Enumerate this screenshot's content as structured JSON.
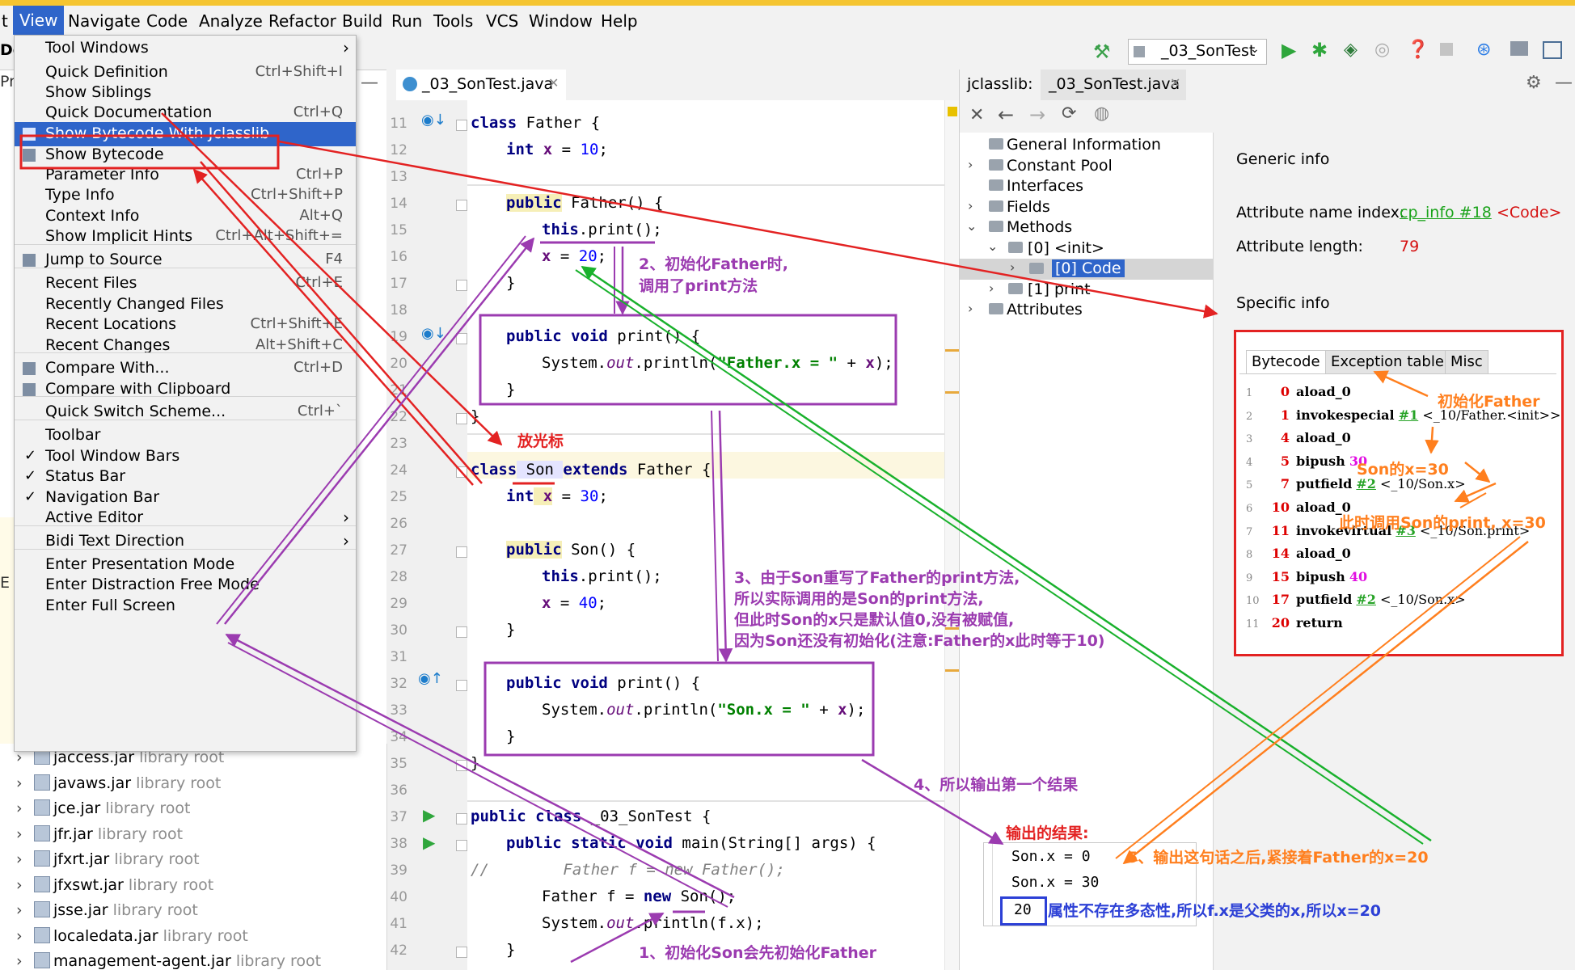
{
  "menubar": {
    "items": [
      "t",
      "View",
      "Navigate",
      "Code",
      "Analyze",
      "Refactor",
      "Build",
      "Run",
      "Tools",
      "VCS",
      "Window",
      "Help"
    ]
  },
  "toolbar": {
    "run_config": "_03_SonTest"
  },
  "left_edge": {
    "de": "De",
    "pro": "Pro",
    "e": "E"
  },
  "view_menu": {
    "items": [
      {
        "label": "Tool Windows",
        "shortcut": "",
        "submenu": true
      },
      {
        "label": "Quick Definition",
        "shortcut": "Ctrl+Shift+I"
      },
      {
        "label": "Show Siblings",
        "shortcut": ""
      },
      {
        "label": "Quick Documentation",
        "shortcut": "Ctrl+Q"
      },
      {
        "label": "Show Bytecode With Jclasslib",
        "shortcut": "",
        "selected": true
      },
      {
        "label": "Show Bytecode",
        "shortcut": ""
      },
      {
        "label": "Parameter Info",
        "shortcut": "Ctrl+P"
      },
      {
        "label": "Type Info",
        "shortcut": "Ctrl+Shift+P"
      },
      {
        "label": "Context Info",
        "shortcut": "Alt+Q"
      },
      {
        "label": "Show Implicit Hints",
        "shortcut": "Ctrl+Alt+Shift+="
      },
      {
        "label": "Jump to Source",
        "shortcut": "F4"
      },
      {
        "label": "Recent Files",
        "shortcut": "Ctrl+E"
      },
      {
        "label": "Recently Changed Files",
        "shortcut": ""
      },
      {
        "label": "Recent Locations",
        "shortcut": "Ctrl+Shift+E"
      },
      {
        "label": "Recent Changes",
        "shortcut": "Alt+Shift+C"
      },
      {
        "label": "Compare With...",
        "shortcut": "Ctrl+D"
      },
      {
        "label": "Compare with Clipboard",
        "shortcut": ""
      },
      {
        "label": "Quick Switch Scheme...",
        "shortcut": "Ctrl+`"
      },
      {
        "label": "Toolbar",
        "shortcut": ""
      },
      {
        "label": "Tool Window Bars",
        "shortcut": "",
        "checked": true
      },
      {
        "label": "Status Bar",
        "shortcut": "",
        "checked": true
      },
      {
        "label": "Navigation Bar",
        "shortcut": "",
        "checked": true
      },
      {
        "label": "Active Editor",
        "shortcut": "",
        "submenu": true
      },
      {
        "label": "Bidi Text Direction",
        "shortcut": "",
        "submenu": true
      },
      {
        "label": "Enter Presentation Mode",
        "shortcut": ""
      },
      {
        "label": "Enter Distraction Free Mode",
        "shortcut": ""
      },
      {
        "label": "Enter Full Screen",
        "shortcut": ""
      }
    ]
  },
  "project_tree": {
    "suffix": "library root",
    "items": [
      "jaccess.jar",
      "javaws.jar",
      "jce.jar",
      "jfr.jar",
      "jfxrt.jar",
      "jfxswt.jar",
      "jsse.jar",
      "localedata.jar",
      "management-agent.jar"
    ]
  },
  "editor": {
    "tab": "_03_SonTest.java",
    "line_numbers": [
      "11",
      "12",
      "13",
      "14",
      "15",
      "16",
      "17",
      "18",
      "19",
      "20",
      "21",
      "22",
      "23",
      "24",
      "25",
      "26",
      "27",
      "28",
      "29",
      "30",
      "31",
      "32",
      "33",
      "34",
      "35",
      "36",
      "37",
      "38",
      "39",
      "40",
      "41",
      "42"
    ],
    "lines": {
      "l11": [
        "class",
        " Father {"
      ],
      "l12": [
        "int",
        " x",
        " = ",
        "10",
        ";"
      ],
      "l14": [
        "public",
        " Father() {"
      ],
      "l15": [
        "this",
        ".print();"
      ],
      "l16": [
        "x",
        " = ",
        "20",
        ";"
      ],
      "l17": "}",
      "l19": [
        "public",
        " ",
        "void",
        " print() {"
      ],
      "l20": [
        "System.",
        "out",
        ".println(",
        "\"Father.x = \"",
        " + ",
        "x",
        ");"
      ],
      "l21": "}",
      "l22": "}",
      "l24": [
        "class",
        " Son ",
        "extends",
        " Father {"
      ],
      "l25": [
        "int",
        " x",
        " = ",
        "30",
        ";"
      ],
      "l27": [
        "public",
        " Son() {"
      ],
      "l28": [
        "this",
        ".print();"
      ],
      "l29": [
        "x",
        " = ",
        "40",
        ";"
      ],
      "l30": "}",
      "l32": [
        "public",
        " ",
        "void",
        " print() {"
      ],
      "l33": [
        "System.",
        "out",
        ".println(",
        "\"Son.x = \"",
        " + ",
        "x",
        ");"
      ],
      "l34": "}",
      "l35": "}",
      "l37": [
        "public",
        " ",
        "class",
        " _03_SonTest {"
      ],
      "l38": [
        "public",
        " ",
        "static",
        " ",
        "void",
        " main(String[] args) {"
      ],
      "l39": [
        "//",
        "        Father f = new Father();"
      ],
      "l40": [
        "Father f = ",
        "new",
        " Son();"
      ],
      "l41": [
        "System.",
        "out",
        ".println(f.x);"
      ],
      "l42": "}"
    }
  },
  "jclasslib": {
    "tab_prefix": "jclasslib:",
    "tab_file": "_03_SonTest.java",
    "tree": [
      "General Information",
      "Constant Pool",
      "Interfaces",
      "Fields",
      "Methods",
      "[0] <init>",
      "[0] Code",
      "[1] print",
      "Attributes"
    ],
    "generic_info": "Generic info",
    "attr_name_label": "Attribute name index:",
    "attr_name_link": "cp_info #18",
    "attr_name_value": "<Code>",
    "attr_len_label": "Attribute length:",
    "attr_len_value": "79",
    "specific_info": "Specific info",
    "tabs": [
      "Bytecode",
      "Exception table",
      "Misc"
    ],
    "bytecode": [
      {
        "n": "1",
        "off": "0",
        "op": "aload_0",
        "arg": "",
        "ref": ""
      },
      {
        "n": "2",
        "off": "1",
        "op": "invokespecial",
        "arg": "#1",
        "ref": " <_10/Father.<init>>"
      },
      {
        "n": "3",
        "off": "4",
        "op": "aload_0",
        "arg": "",
        "ref": ""
      },
      {
        "n": "4",
        "off": "5",
        "op": "bipush",
        "arg": "30",
        "ref": ""
      },
      {
        "n": "5",
        "off": "7",
        "op": "putfield",
        "arg": "#2",
        "ref": " <_10/Son.x>"
      },
      {
        "n": "6",
        "off": "10",
        "op": "aload_0",
        "arg": "",
        "ref": ""
      },
      {
        "n": "7",
        "off": "11",
        "op": "invokevirtual",
        "arg": "#3",
        "ref": " <_10/Son.print>"
      },
      {
        "n": "8",
        "off": "14",
        "op": "aload_0",
        "arg": "",
        "ref": ""
      },
      {
        "n": "9",
        "off": "15",
        "op": "bipush",
        "arg": "40",
        "ref": ""
      },
      {
        "n": "10",
        "off": "17",
        "op": "putfield",
        "arg": "#2",
        "ref": " <_10/Son.x>"
      },
      {
        "n": "11",
        "off": "20",
        "op": "return",
        "arg": "",
        "ref": ""
      }
    ]
  },
  "output": {
    "title": "输出的结果:",
    "lines": [
      "Son.x = 0",
      "Son.x = 30"
    ],
    "result": "20"
  },
  "annotations": {
    "a1": "1、初始化Son会先初始化Father",
    "a2_1": "2、初始化Father时,",
    "a2_2": "调用了print方法",
    "a3_1": "3、由于Son重写了Father的print方法,",
    "a3_2": "所以实际调用的是Son的print方法,",
    "a3_3": "但此时Son的x只是默认值0,没有被赋值,",
    "a3_4": "因为Son还没有初始化(注意:Father的x此时等于10)",
    "a4": "4、所以输出第一个结果",
    "a5": "5、输出这句话之后,紧接着Father的x=20",
    "cursor": "放光标",
    "init_father": "初始化Father",
    "son_x30": "Son的x=30",
    "son_print": "此时调用Son的print, x=30",
    "poly": "属性不存在多态性,所以f.x是父类的x,所以x=20"
  },
  "colors": {
    "accent": "#2f65ca",
    "red_box": "#e32222",
    "purple": "#9b3bb0",
    "green": "#19b12c",
    "orange": "#ff7f1e",
    "blue_text": "#2c40d6"
  }
}
